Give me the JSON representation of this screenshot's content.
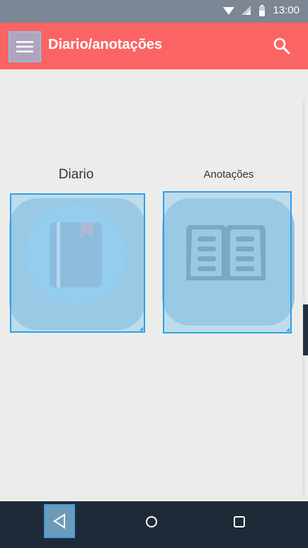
{
  "status_bar": {
    "time": "13:00",
    "icons": [
      "wifi-icon",
      "signal-icon",
      "battery-icon"
    ]
  },
  "app_bar": {
    "title": "Diario/anotações",
    "menu_icon": "hamburger-menu-icon",
    "search_icon": "search-icon"
  },
  "tiles": [
    {
      "label": "Diario",
      "icon": "diary-book-icon"
    },
    {
      "label": "Anotações",
      "icon": "open-book-icon"
    }
  ],
  "nav_bar": {
    "buttons": [
      "back-icon",
      "home-icon",
      "recents-icon"
    ]
  },
  "colors": {
    "app_bar": "#fb6464",
    "status_bar": "#7c8694",
    "background": "#ecedea",
    "nav_bar": "#1f2a39",
    "selection": "#2ea0ea"
  }
}
